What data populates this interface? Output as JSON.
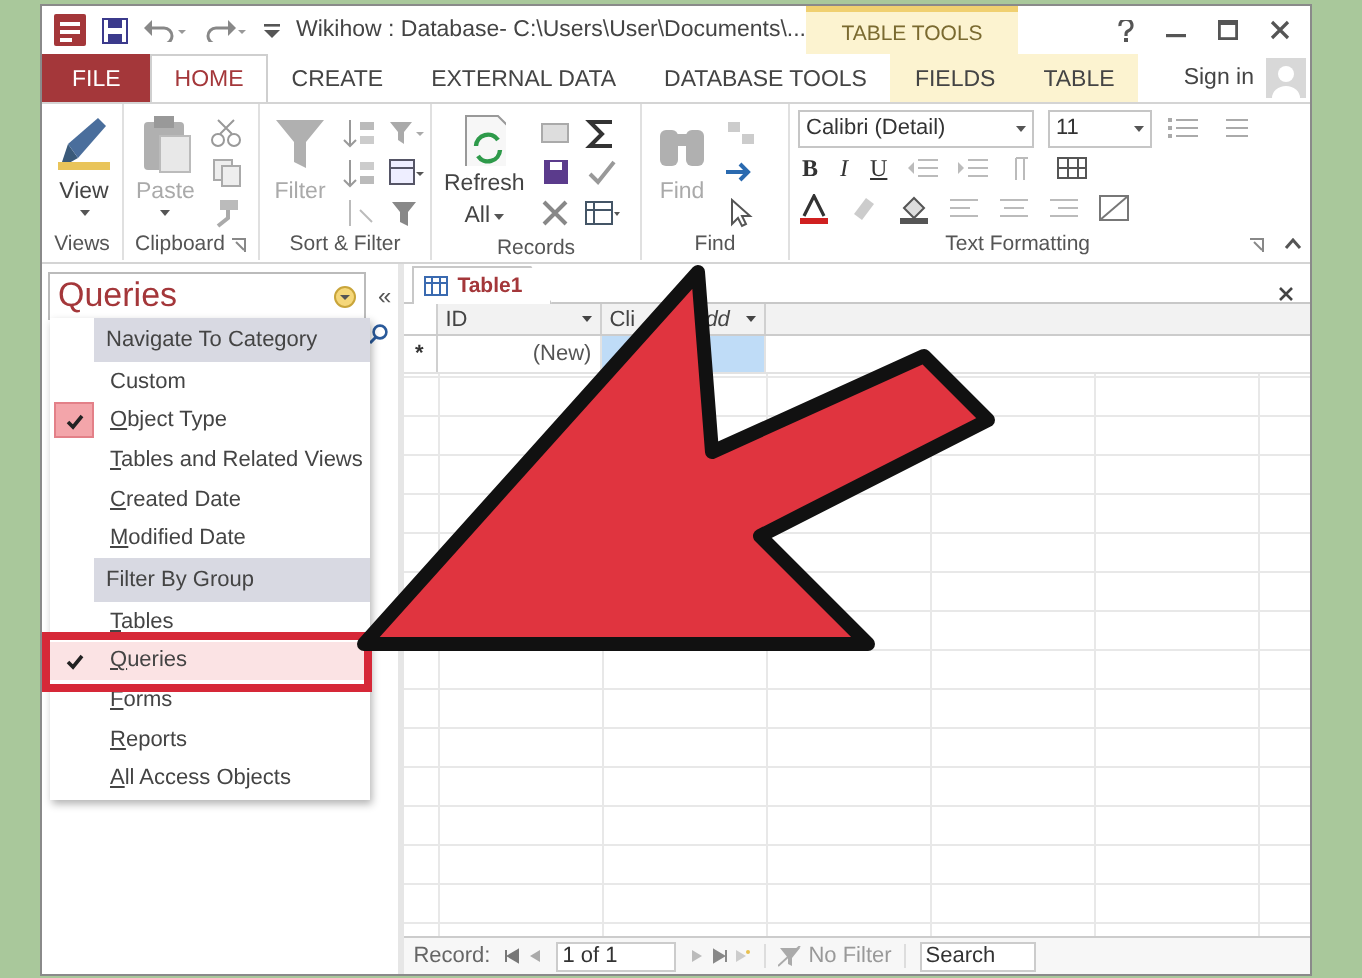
{
  "window": {
    "title": "Wikihow : Database- C:\\Users\\User\\Documents\\...",
    "context_group": "TABLE TOOLS",
    "sign_in": "Sign in"
  },
  "tabs": [
    {
      "label": "FILE",
      "kind": "file",
      "selected": false
    },
    {
      "label": "HOME",
      "kind": "main",
      "selected": true
    },
    {
      "label": "CREATE",
      "kind": "main",
      "selected": false
    },
    {
      "label": "EXTERNAL DATA",
      "kind": "main",
      "selected": false
    },
    {
      "label": "DATABASE TOOLS",
      "kind": "main",
      "selected": false
    },
    {
      "label": "FIELDS",
      "kind": "context",
      "selected": false
    },
    {
      "label": "TABLE",
      "kind": "context",
      "selected": false
    }
  ],
  "ribbon": {
    "groups": [
      {
        "label": "Views",
        "button": {
          "label": "View",
          "disabled": false
        }
      },
      {
        "label": "Clipboard",
        "button": {
          "label": "Paste",
          "disabled": true
        }
      },
      {
        "label": "Sort & Filter",
        "button": {
          "label": "Filter",
          "disabled": true
        }
      },
      {
        "label": "Records",
        "button": {
          "label": "Refresh",
          "label_line_2": "All",
          "disabled": false
        }
      },
      {
        "label": "Find",
        "button": {
          "label": "Find",
          "disabled": true
        }
      },
      {
        "label": "Text Formatting",
        "font": "Calibri (Detail)",
        "size": "11",
        "format_buttons": [
          "B",
          "I",
          "U"
        ]
      }
    ]
  },
  "navigation_pane": {
    "title": "Queries",
    "collapse": "«",
    "menu": [
      {
        "label": "Navigate To Category",
        "kind": "header"
      },
      {
        "label": "Custom",
        "kind": "option",
        "checked": false,
        "selected": false,
        "key_underlined": false
      },
      {
        "label": "Object Type",
        "kind": "option",
        "checked": true,
        "selected": false,
        "key_underlined": true
      },
      {
        "label": "Tables and Related Views",
        "kind": "option",
        "checked": false,
        "selected": false,
        "key_underlined": true
      },
      {
        "label": "Created Date",
        "kind": "option",
        "checked": false,
        "selected": false,
        "key_underlined": true
      },
      {
        "label": "Modified Date",
        "kind": "option",
        "checked": false,
        "selected": false,
        "key_underlined": true
      },
      {
        "label": "Filter By Group",
        "kind": "header"
      },
      {
        "label": "Tables",
        "kind": "option",
        "checked": false,
        "selected": false,
        "key_underlined": true
      },
      {
        "label": "Queries",
        "kind": "option",
        "checked": true,
        "selected": true,
        "key_underlined": true
      },
      {
        "label": "Forms",
        "kind": "option",
        "checked": false,
        "selected": false,
        "key_underlined": true
      },
      {
        "label": "Reports",
        "kind": "option",
        "checked": false,
        "selected": false,
        "key_underlined": true
      },
      {
        "label": "All Access Objects",
        "kind": "option",
        "checked": false,
        "selected": false,
        "key_underlined": true
      }
    ]
  },
  "document": {
    "tab": {
      "label": "Table1",
      "selected": true
    },
    "columns": [
      {
        "label": "ID"
      },
      {
        "label": "Cli",
        "label_after_cover": "dd"
      }
    ],
    "rows": [
      {
        "selector": "*",
        "cells": [
          {
            "text": "(New)",
            "selected": false
          },
          {
            "selected": true
          }
        ]
      }
    ]
  },
  "status_bar": {
    "record_label": "Record:",
    "position": "1 of 1",
    "filter": "No Filter",
    "filter_disabled": true,
    "search_placeholder": "Search"
  }
}
